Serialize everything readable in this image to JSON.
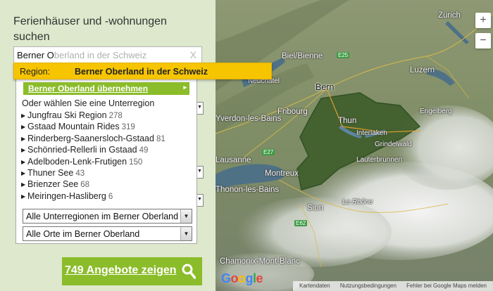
{
  "panel": {
    "title": "Ferienhäuser und -wohnungen suchen",
    "search": {
      "typed": "Berner O",
      "ghost_rest": "berland in der Schweiz",
      "clear_label": "X"
    },
    "suggestion": {
      "label": "Region:",
      "bold_part": "Berner O",
      "rest": "berland in der Schweiz"
    },
    "dropdown": {
      "take_button": "Berner Oberland übernehmen",
      "take_arrow": "▸",
      "subregion_heading": "Oder wählen Sie eine Unterregion",
      "regions": [
        {
          "name": "Jungfrau Ski Region",
          "count": "278"
        },
        {
          "name": "Gstaad Mountain Rides",
          "count": "319"
        },
        {
          "name": "Rinderberg-Saanersloch-Gstaad",
          "count": "81"
        },
        {
          "name": "Schönried-Rellerli in Gstaad",
          "count": "49"
        },
        {
          "name": "Adelboden-Lenk-Frutigen",
          "count": "150"
        },
        {
          "name": "Thuner See",
          "count": "43"
        },
        {
          "name": "Brienzer See",
          "count": "68"
        },
        {
          "name": "Meiringen-Hasliberg",
          "count": "6"
        }
      ],
      "select_subregions": "Alle Unterregionen im Berner Oberland",
      "select_places": "Alle Orte im Berner Oberland"
    },
    "cta": {
      "label": "749 Angebote zeigen"
    }
  },
  "map": {
    "places": {
      "zurich": "Zürich",
      "biel": "Biel/Bienne",
      "luzern": "Luzern",
      "neuchatel": "Neuchâtel",
      "bern": "Bern",
      "fribourg": "Fribourg",
      "engelberg": "Engelberg",
      "yverdon": "Yverdon-les-Bains",
      "thun": "Thun",
      "interlaken": "Interlaken",
      "grindelwald": "Grindelwald",
      "lauterbrunnen": "Lauterbrunnen",
      "lausanne": "Lausanne",
      "montreux": "Montreux",
      "thonon": "Thonon-les-Bains",
      "sion": "Sion",
      "rhone": "Le Rhône",
      "chamonix": "Chamonix-Mont-Blanc"
    },
    "roads": {
      "e25": "E25",
      "e27": "E27",
      "e62": "E62"
    },
    "zoom_in": "+",
    "zoom_out": "−",
    "logo_letters": [
      "G",
      "o",
      "o",
      "g",
      "l",
      "e"
    ],
    "attribution": {
      "kartendaten": "Kartendaten",
      "terms": "Nutzungsbedingungen",
      "report": "Fehler bei Google Maps melden"
    }
  },
  "colors": {
    "accent_green": "#8bbc2a",
    "suggestion_yellow": "#f6c500",
    "panel_bg": "#dde8cc"
  }
}
